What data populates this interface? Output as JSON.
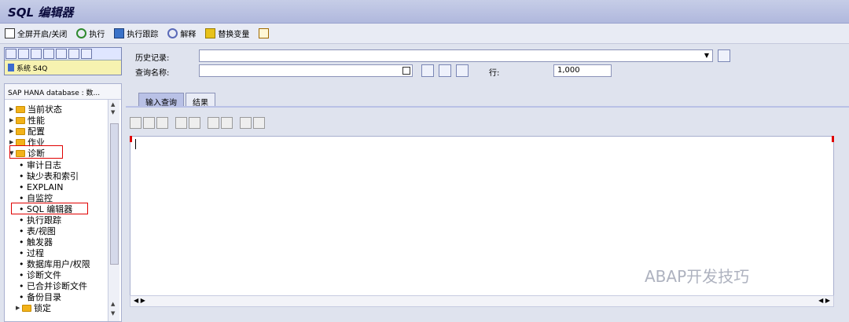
{
  "window": {
    "title": "SQL 编辑器"
  },
  "toolbar": {
    "fullscreen": "全屏开启/关闭",
    "execute": "执行",
    "trace": "执行跟踪",
    "explain": "解释",
    "replace": "替换变量"
  },
  "system": {
    "label": "系统 S4Q"
  },
  "form": {
    "history_label": "历史记录:",
    "query_label": "查询名称:",
    "row_label": "行:",
    "row_value": "1,000"
  },
  "tabs": [
    {
      "label": "输入查询"
    },
    {
      "label": "结果"
    }
  ],
  "tree": {
    "header": "SAP HANA database : 数...",
    "items": [
      {
        "label": "当前状态"
      },
      {
        "label": "性能"
      },
      {
        "label": "配置"
      },
      {
        "label": "作业"
      },
      {
        "label": "诊断"
      },
      {
        "label": "审计日志"
      },
      {
        "label": "缺少表和索引"
      },
      {
        "label": "EXPLAIN"
      },
      {
        "label": "自监控"
      },
      {
        "label": "SQL 编辑器"
      },
      {
        "label": "执行跟踪"
      },
      {
        "label": "表/视图"
      },
      {
        "label": "触发器"
      },
      {
        "label": "过程"
      },
      {
        "label": "数据库用户/权限"
      },
      {
        "label": "诊断文件"
      },
      {
        "label": "已合并诊断文件"
      },
      {
        "label": "备份目录"
      },
      {
        "label": "锁定"
      }
    ]
  },
  "watermark": "ABAP开发技巧"
}
